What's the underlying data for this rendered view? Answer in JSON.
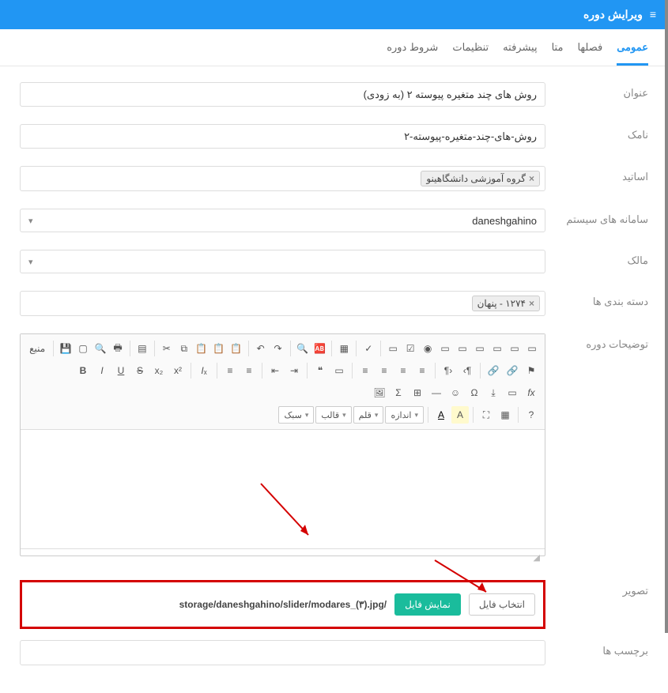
{
  "header": {
    "title": "ویرایش دوره"
  },
  "tabs": [
    {
      "label": "عمومی",
      "active": true
    },
    {
      "label": "فصلها"
    },
    {
      "label": "متا"
    },
    {
      "label": "پیشرفته"
    },
    {
      "label": "تنظیمات"
    },
    {
      "label": "شروط دوره"
    }
  ],
  "fields": {
    "title_label": "عنوان",
    "title_value": "روش های چند متغیره پیوسته ۲ (به زودی)",
    "slug_label": "نامک",
    "slug_value": "روش-های-چند-متغیره-پیوسته-۲",
    "teachers_label": "اساتید",
    "teachers_tag": "گروه آموزشی دانشگاهینو",
    "systems_label": "سامانه های سیستم",
    "systems_value": "daneshgahino",
    "owner_label": "مالک",
    "owner_value": "",
    "categories_label": "دسته بندی ها",
    "categories_tag": "۱۲۷۴ - پنهان",
    "description_label": "توضیحات دوره",
    "image_label": "تصویر",
    "image_path": "storage/daneshgahino/slider/modares_(۳).jpg/",
    "btn_choose": "انتخاب فایل",
    "btn_show": "نمایش فایل",
    "tags_label": "برچسب ها"
  },
  "editor": {
    "source_label": "منبع",
    "combo_style": "سبک",
    "combo_format": "قالب",
    "combo_font": "قلم",
    "combo_size": "اندازه"
  }
}
